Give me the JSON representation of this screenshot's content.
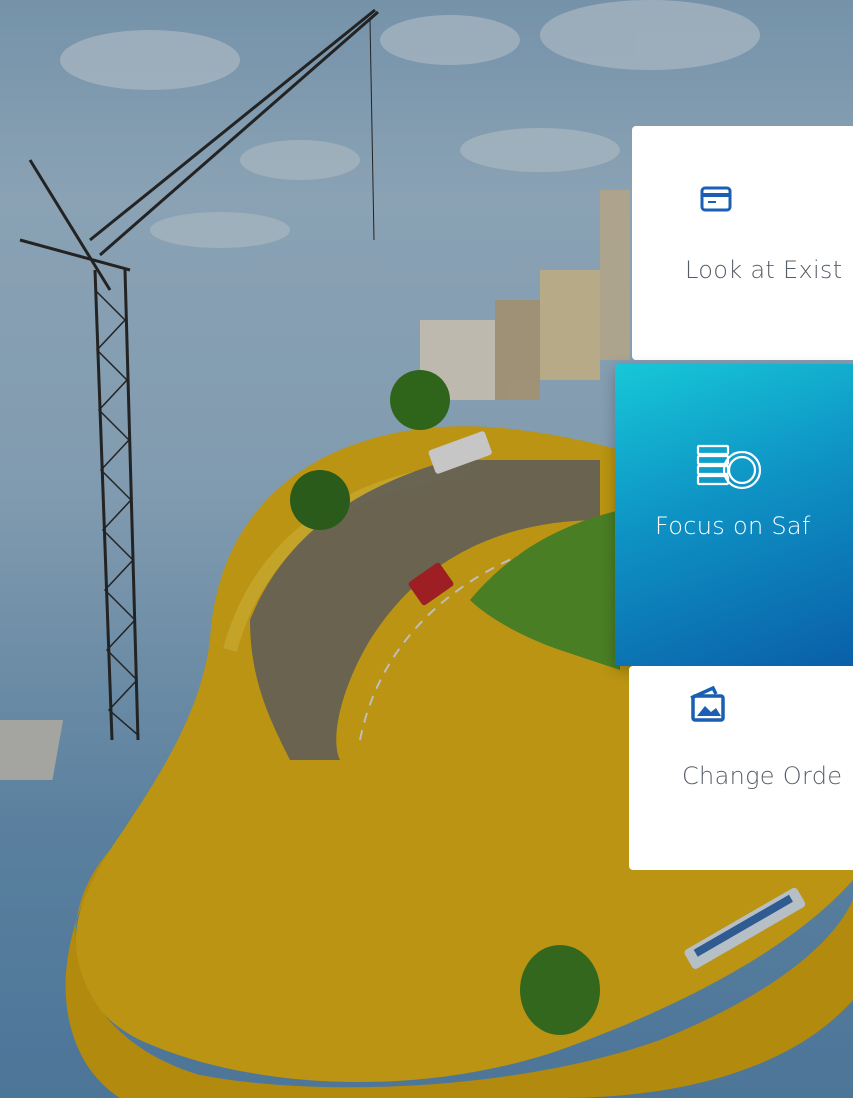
{
  "cards": [
    {
      "label": "Look at Exist",
      "icon": "credit-card-icon",
      "state": "default"
    },
    {
      "label": "Focus on Saf",
      "icon": "coins-stack-icon",
      "state": "active"
    },
    {
      "label": "Change Orde",
      "icon": "images-icon",
      "state": "default"
    }
  ],
  "colors": {
    "accent": "#0a5fa8",
    "active_gradient_start": "#17c7d8",
    "icon_blue": "#1a5fb4",
    "label_gray": "#555d66"
  }
}
